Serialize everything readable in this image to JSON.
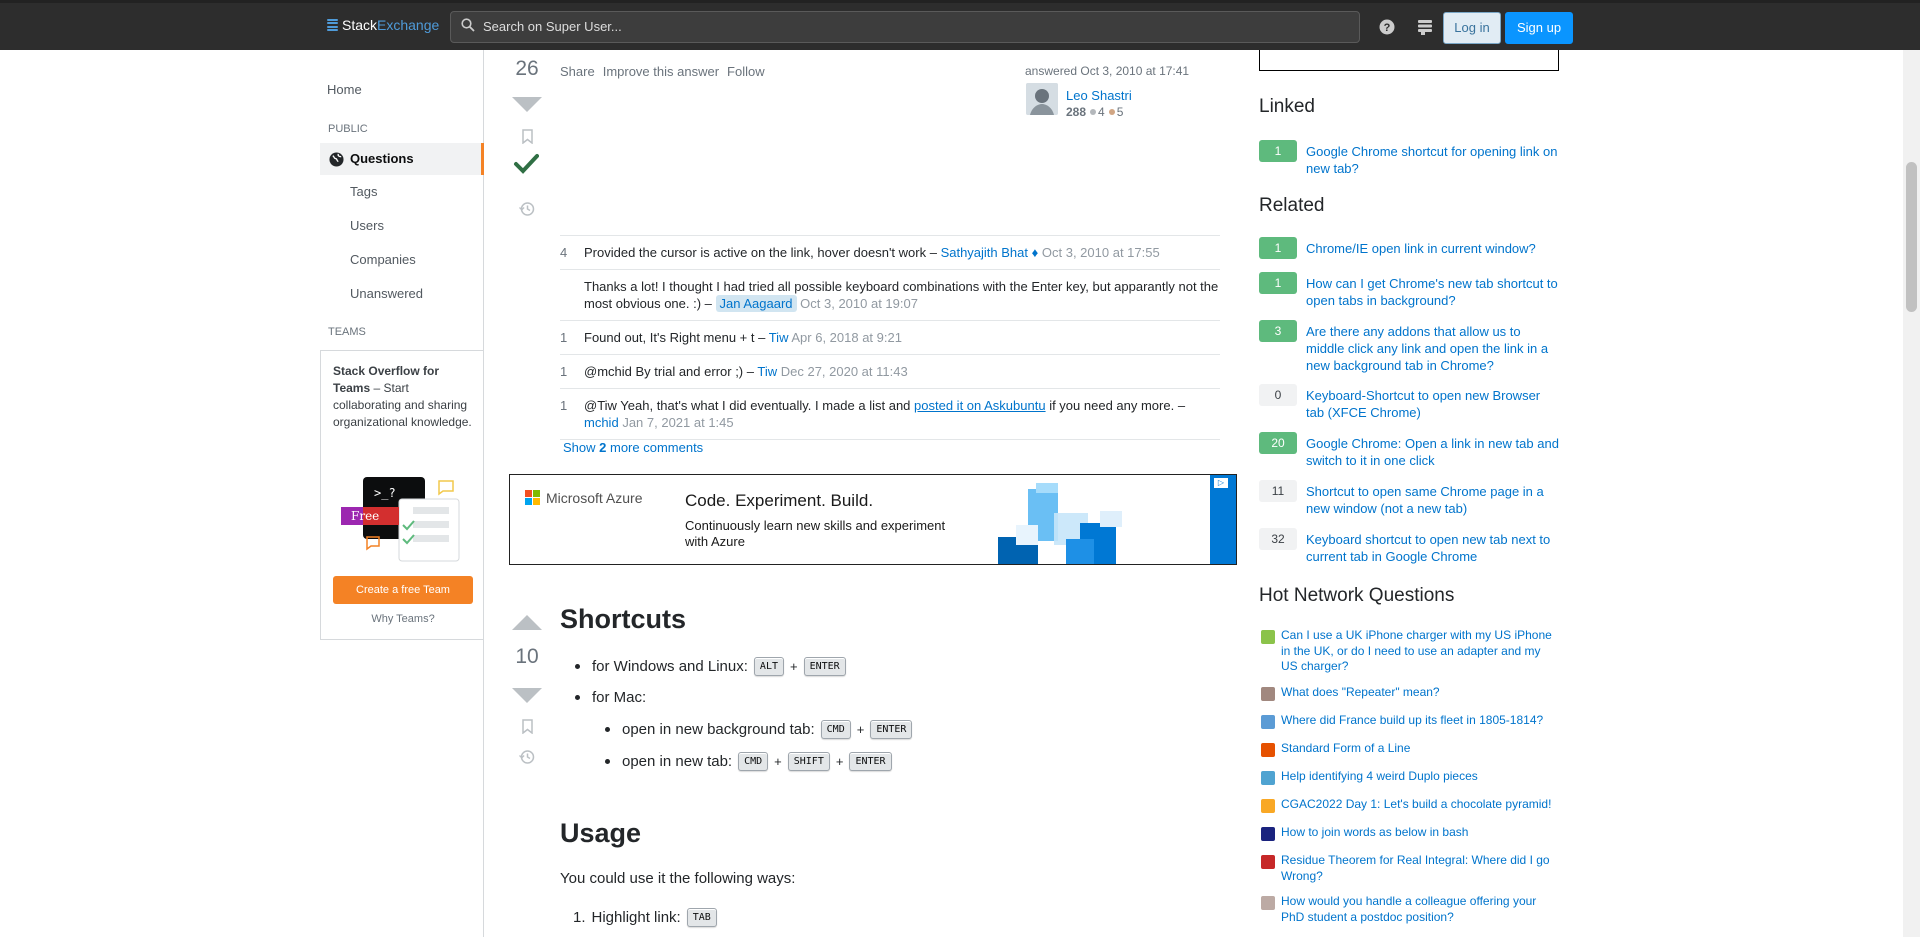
{
  "topbar": {
    "brand_a": "Stack",
    "brand_b": "Exchange",
    "search_placeholder": "Search on Super User...",
    "login_label": "Log in",
    "signup_label": "Sign up"
  },
  "leftnav": {
    "home": "Home",
    "public_label": "PUBLIC",
    "questions": "Questions",
    "tags": "Tags",
    "users": "Users",
    "companies": "Companies",
    "unanswered": "Unanswered",
    "teams_label": "TEAMS",
    "teams_title": "Stack Overflow for Teams",
    "teams_desc": " – Start collaborating and sharing organizational knowledge.",
    "teams_free": "Free",
    "teams_prompt": ">_?",
    "create_team": "Create a free Team",
    "why_teams": "Why Teams?"
  },
  "answer1": {
    "votes": "26",
    "menu": [
      "Share",
      "Improve this answer",
      "Follow"
    ],
    "answered": "answered Oct 3, 2010 at 17:41",
    "user": "Leo Shastri",
    "rep": "288",
    "silver": "4",
    "bronze": "5",
    "comments": [
      {
        "score": "4",
        "text": "Provided the cursor is active on the link, hover doesn't work – ",
        "user": "Sathyajith Bhat",
        "user_suffix": " ♦",
        "date": "Oct 3, 2010 at 17:55"
      },
      {
        "score": "",
        "text": "Thanks a lot! I thought I had tried all possible keyboard combinations with the Enter key, but apparantly not the most obvious one. :) – ",
        "user": "Jan Aagaard",
        "date": "Oct 3, 2010 at 19:07"
      },
      {
        "score": "1",
        "text": "Found out, It's Right menu + t – ",
        "user": "Tiw",
        "date": "Apr 6, 2018 at 9:21"
      },
      {
        "score": "1",
        "text": "@mchid By trial and error ;) – ",
        "user": "Tiw",
        "date": "Dec 27, 2020 at 11:43"
      },
      {
        "score": "1",
        "text": "@Tiw Yeah, that's what I did eventually. I made a list and ",
        "link": "posted it on Askubuntu",
        "text2": " if you need any more. – ",
        "user": "mchid",
        "date": "Jan 7, 2021 at 1:45"
      }
    ],
    "show_more_prefix": "Show ",
    "show_more_count": "2",
    "show_more_suffix": " more comments"
  },
  "ad": {
    "brand": "Microsoft Azure",
    "headline": "Code. Experiment. Build.",
    "sub": "Continuously learn new skills and experiment with Azure",
    "choice": "▷"
  },
  "answer2": {
    "votes": "10",
    "h_shortcuts": "Shortcuts",
    "win_label": "for Windows and Linux:",
    "mac_label": "for Mac:",
    "bg_tab_label": "open in new background tab:",
    "new_tab_label": "open in new tab:",
    "keys": {
      "alt": "ALT",
      "enter": "ENTER",
      "cmd": "CMD",
      "shift": "SHIFT",
      "tab": "TAB"
    },
    "plus": "+",
    "h_usage": "Usage",
    "usage_intro": "You could use it the following ways:",
    "step1_num": "1.",
    "step1": "Highlight link:"
  },
  "sidebar": {
    "linked_title": "Linked",
    "linked": [
      {
        "count": "1",
        "text": "Google Chrome shortcut for opening link on new tab?",
        "answered": true
      }
    ],
    "related_title": "Related",
    "related": [
      {
        "count": "1",
        "text": "Chrome/IE open link in current window?",
        "answered": true
      },
      {
        "count": "1",
        "text": "How can I get Chrome's new tab shortcut to open tabs in background?",
        "answered": true
      },
      {
        "count": "3",
        "text": "Are there any addons that allow us to middle click any link and open the link in a new background tab in Chrome?",
        "answered": true
      },
      {
        "count": "0",
        "text": "Keyboard-Shortcut to open new Browser tab (XFCE Chrome)",
        "answered": false
      },
      {
        "count": "20",
        "text": "Google Chrome: Open a link in new tab and switch to it in one click",
        "answered": true
      },
      {
        "count": "11",
        "text": "Shortcut to open same Chrome page in a new window (not a new tab)",
        "answered": false
      },
      {
        "count": "32",
        "text": "Keyboard shortcut to open new tab next to current tab in Google Chrome",
        "answered": false
      }
    ],
    "hot_title": "Hot Network Questions",
    "hot": [
      {
        "text": "Can I use a UK iPhone charger with my US iPhone in the UK, or do I need to use an adapter and my US charger?",
        "color": "#8bc34a"
      },
      {
        "text": "What does \"Repeater\" mean?",
        "color": "#a1887f"
      },
      {
        "text": "Where did France build up its fleet in 1805-1814?",
        "color": "#5b9bd5"
      },
      {
        "text": "Standard Form of a Line",
        "color": "#e65100"
      },
      {
        "text": "Help identifying 4 weird Duplo pieces",
        "color": "#4fa3d1"
      },
      {
        "text": "CGAC2022 Day 1: Let's build a chocolate pyramid!",
        "color": "#f9a825"
      },
      {
        "text": "How to join words as below in bash",
        "color": "#1a237e"
      },
      {
        "text": "Residue Theorem for Real Integral: Where did I go Wrong?",
        "color": "#c62828"
      },
      {
        "text": "How would you handle a colleague offering your PhD student a postdoc position?",
        "color": "#bcaaa4"
      }
    ]
  }
}
